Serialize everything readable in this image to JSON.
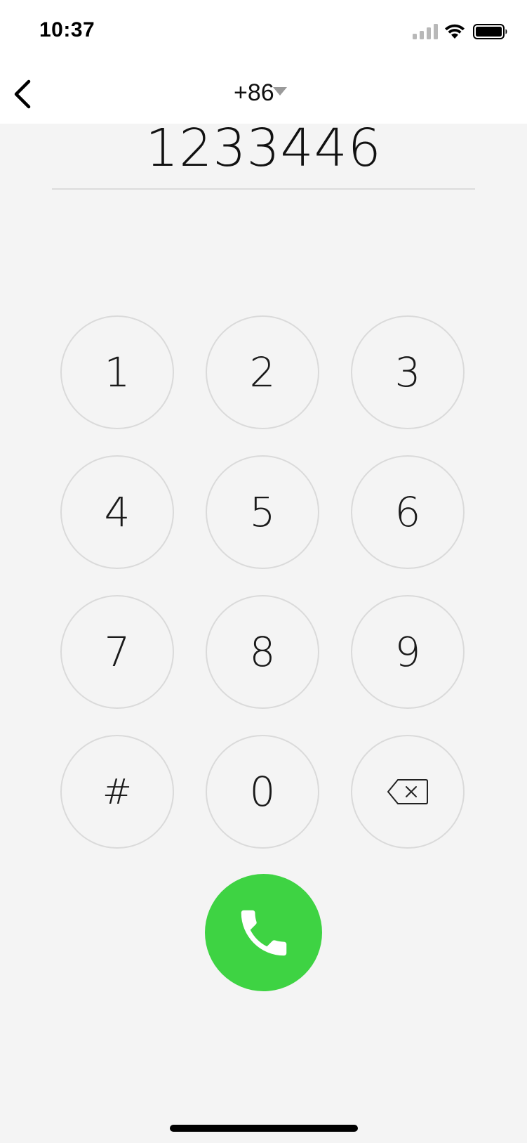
{
  "status_bar": {
    "time": "10:37",
    "signal_icon": "cellular-signal-icon",
    "wifi_icon": "wifi-icon",
    "battery_icon": "battery-icon"
  },
  "nav": {
    "back_icon": "chevron-left-icon",
    "country_code": "+86",
    "dropdown_icon": "caret-down-icon"
  },
  "dial": {
    "number": "1233446"
  },
  "keypad": {
    "keys": [
      {
        "label": "1"
      },
      {
        "label": "2"
      },
      {
        "label": "3"
      },
      {
        "label": "4"
      },
      {
        "label": "5"
      },
      {
        "label": "6"
      },
      {
        "label": "7"
      },
      {
        "label": "8"
      },
      {
        "label": "9"
      },
      {
        "label": "#"
      },
      {
        "label": "0"
      }
    ],
    "delete_icon": "backspace-icon"
  },
  "call": {
    "icon": "phone-handset-icon",
    "color": "#3ed343"
  },
  "colors": {
    "background": "#f4f4f4",
    "bar": "#ffffff",
    "key_border": "#dadada"
  }
}
